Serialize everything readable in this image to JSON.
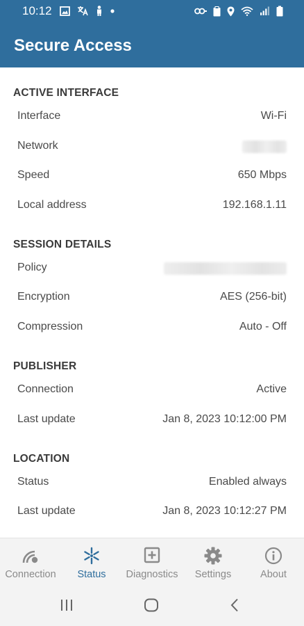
{
  "status_bar": {
    "time": "10:12",
    "left_icons": [
      "image-icon",
      "translate-icon",
      "person-icon",
      "dot-icon"
    ],
    "right_icons": [
      "key-icon",
      "clipboard-icon",
      "location-icon",
      "wifi-icon",
      "signal-icon",
      "battery-icon"
    ]
  },
  "app_bar": {
    "title": "Secure Access",
    "background": "#2f6e9d"
  },
  "sections": {
    "active_interface": {
      "header": "ACTIVE INTERFACE",
      "interface_label": "Interface",
      "interface_value": "Wi-Fi",
      "network_label": "Network",
      "speed_label": "Speed",
      "speed_value": "650 Mbps",
      "local_address_label": "Local address",
      "local_address_value": "192.168.1.11"
    },
    "session_details": {
      "header": "SESSION DETAILS",
      "policy_label": "Policy",
      "encryption_label": "Encryption",
      "encryption_value": "AES (256-bit)",
      "compression_label": "Compression",
      "compression_value": "Auto - Off"
    },
    "publisher": {
      "header": "PUBLISHER",
      "connection_label": "Connection",
      "connection_value": "Active",
      "last_update_label": "Last update",
      "last_update_value": "Jan 8, 2023 10:12:00 PM"
    },
    "location": {
      "header": "LOCATION",
      "status_label": "Status",
      "status_value": "Enabled always",
      "last_update_label": "Last update",
      "last_update_value": "Jan 8, 2023 10:12:27 PM"
    }
  },
  "bottom_nav": {
    "active_color": "#2f6e9d",
    "inactive_color": "#8a8a8a",
    "items": [
      {
        "label": "Connection",
        "icon": "signal-waves-icon",
        "active": false
      },
      {
        "label": "Status",
        "icon": "snowflake-icon",
        "active": true
      },
      {
        "label": "Diagnostics",
        "icon": "plus-box-icon",
        "active": false
      },
      {
        "label": "Settings",
        "icon": "gear-icon",
        "active": false
      },
      {
        "label": "About",
        "icon": "info-icon",
        "active": false
      }
    ]
  },
  "system_nav": [
    "recents-icon",
    "home-icon",
    "back-icon"
  ]
}
